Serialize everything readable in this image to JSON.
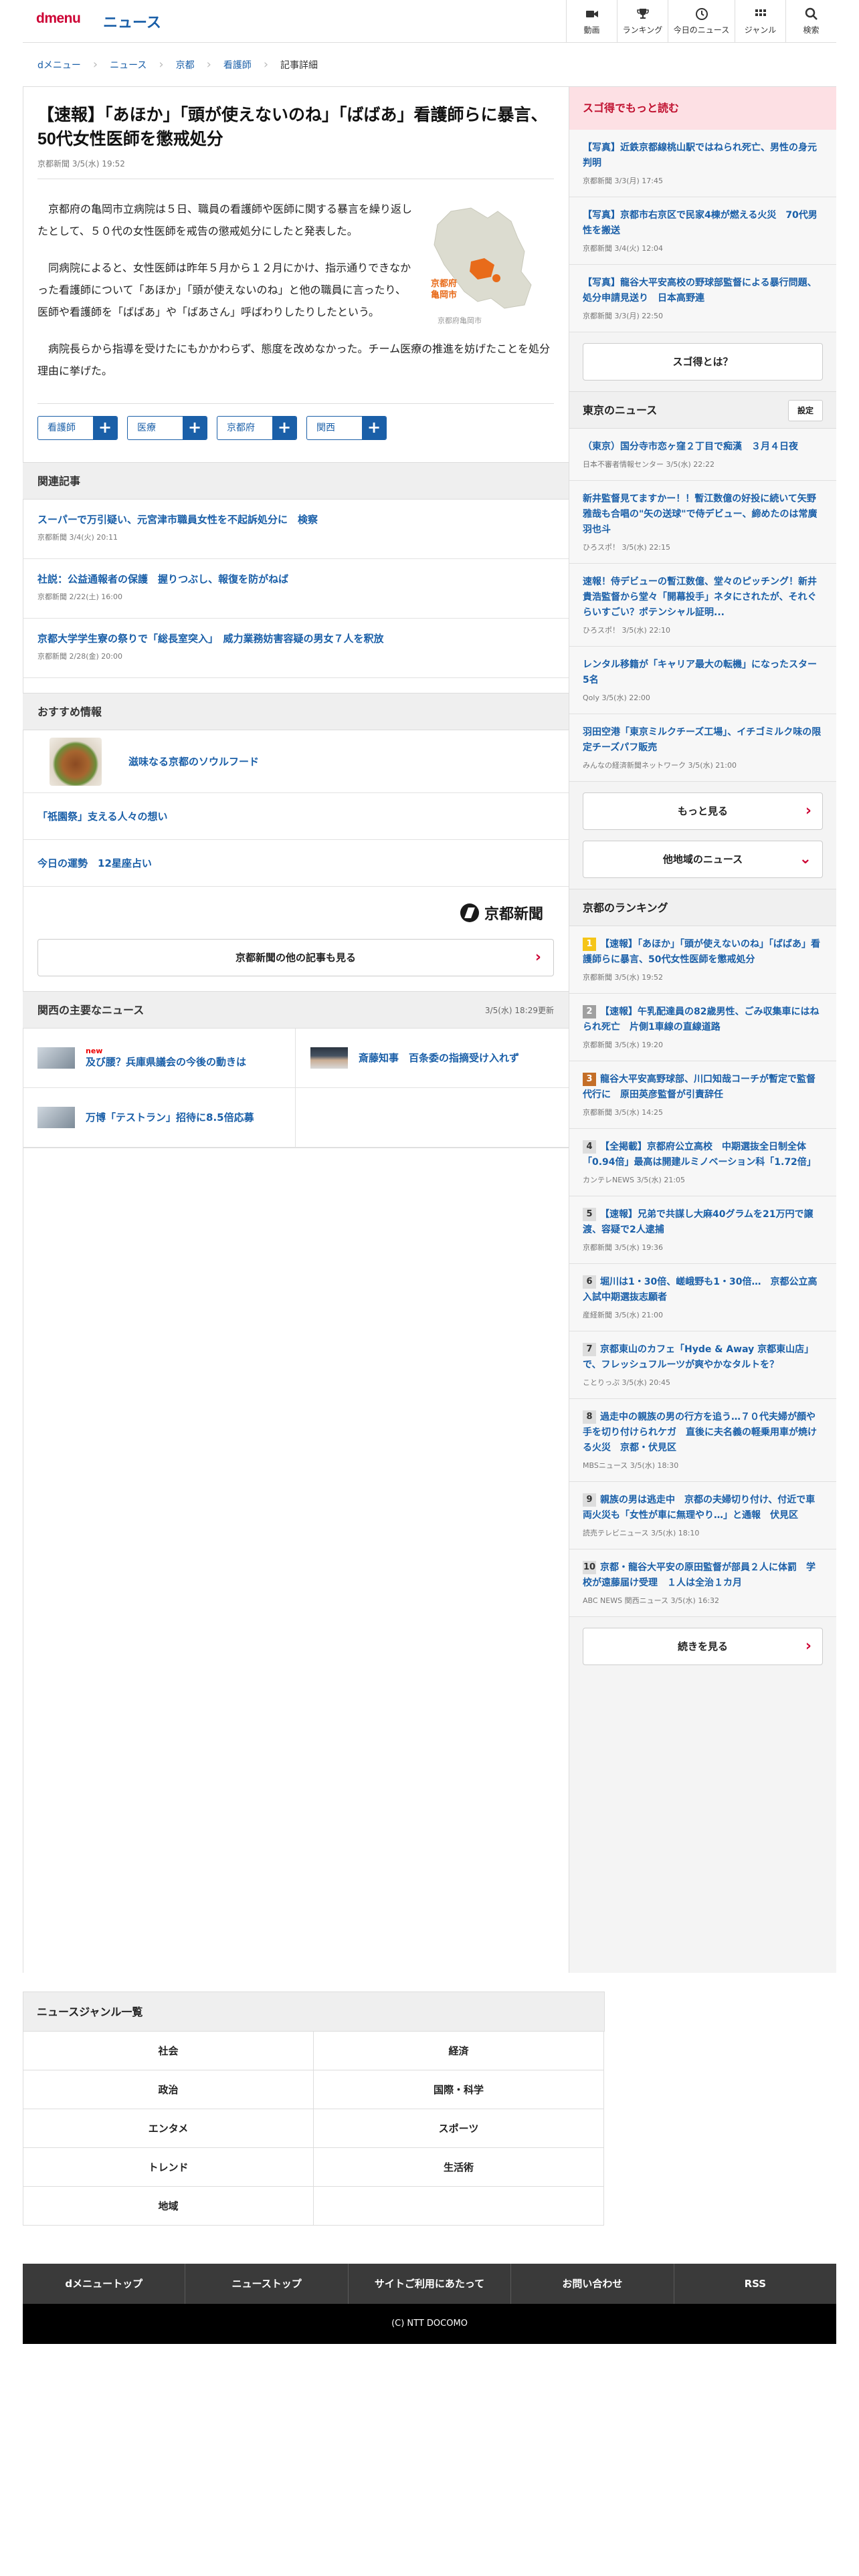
{
  "header": {
    "logo": "dmenu",
    "title": "ニュース",
    "nav": [
      {
        "label": "動画",
        "icon": "video-icon"
      },
      {
        "label": "ランキング",
        "icon": "trophy-icon"
      },
      {
        "label": "今日のニュース",
        "icon": "clock-icon"
      },
      {
        "label": "ジャンル",
        "icon": "grid-icon"
      },
      {
        "label": "検索",
        "icon": "search-icon"
      }
    ]
  },
  "breadcrumb": [
    "dメニュー",
    "ニュース",
    "京都",
    "看護師",
    "記事詳細"
  ],
  "article": {
    "title": "【速報】「あほか」「頭が使えないのね」「ばばあ」看護師らに暴言、50代女性医師を懲戒処分",
    "meta": "京都新聞 3/5(水) 19:52",
    "paragraphs": [
      "京都府の亀岡市立病院は５日、職員の看護師や医師に関する暴言を繰り返したとして、５０代の女性医師を戒告の懲戒処分にしたと発表した。",
      "同病院によると、女性医師は昨年５月から１２月にかけ、指示通りできなかった看護師について「あほか」「頭が使えないのね」と他の職員に言ったり、医師や看護師を「ばばあ」や「ばあさん」呼ばわりしたりしたという。",
      "病院長らから指導を受けたにもかかわらず、態度を改めなかった。チーム医療の推進を妨げたことを処分理由に挙げた。"
    ],
    "map_label_line1": "京都府",
    "map_label_line2": "亀岡市",
    "map_caption": "京都府亀岡市",
    "tags": [
      "看護師",
      "医療",
      "京都府",
      "関西"
    ]
  },
  "related": {
    "heading": "関連記事",
    "items": [
      {
        "title": "スーパーで万引疑い、元宮津市職員女性を不起訴処分に　検察",
        "meta": "京都新聞 3/4(火) 20:11"
      },
      {
        "title": "社説：公益通報者の保護　握りつぶし、報復を防がねば",
        "meta": "京都新聞 2/22(土) 16:00"
      },
      {
        "title": "京都大学学生寮の祭りで「総長室突入」　威力業務妨害容疑の男女７人を釈放",
        "meta": "京都新聞 2/28(金) 20:00"
      }
    ]
  },
  "recommended": {
    "heading": "おすすめ情報",
    "featured": "滋味なる京都のソウルフード",
    "items": [
      "「祇園祭」支える人々の想い",
      "今日の運勢　12星座占い"
    ],
    "publisher": "京都新聞",
    "more_button": "京都新聞の他の記事も見る"
  },
  "kansai": {
    "heading": "関西の主要なニュース",
    "updated": "3/5(水) 18:29更新",
    "items": [
      {
        "title": "及び腰？兵庫県議会の今後の動きは",
        "badge": "new"
      },
      {
        "title": "斎藤知事　百条委の指摘受け入れず",
        "badge": ""
      },
      {
        "title": "万博「テストラン」招待に8.5倍応募",
        "badge": ""
      }
    ]
  },
  "sidebar": {
    "promo_heading": "スゴ得でもっと読む",
    "promo_items": [
      {
        "title": "【写真】近鉄京都線桃山駅ではねられ死亡、男性の身元判明",
        "meta": "京都新聞 3/3(月) 17:45"
      },
      {
        "title": "【写真】京都市右京区で民家4棟が燃える火災　70代男性を搬送",
        "meta": "京都新聞 3/4(火) 12:04"
      },
      {
        "title": "【写真】龍谷大平安高校の野球部監督による暴行問題、処分申請見送り　日本高野連",
        "meta": "京都新聞 3/3(月) 22:50"
      }
    ],
    "promo_button": "スゴ得とは？",
    "tokyo_heading": "東京のニュース",
    "setting_label": "設定",
    "tokyo_items": [
      {
        "title": "（東京）国分寺市恋ヶ窪２丁目で痴漢　３月４日夜",
        "meta": "日本不審者情報センター 3/5(水) 22:22"
      },
      {
        "title": "新井監督見てますかー！！暫江数億の好投に続いて矢野雅哉も合唱の\"矢の送球\"で侍デビュー、締めたのは常廣羽也斗",
        "meta": "ひろスポ！ 3/5(水) 22:15"
      },
      {
        "title": "速報！侍デビューの暫江数億、堂々のピッチング！新井貴浩監督から堂々「開幕投手」ネタにされたが、それぐらいすごい？ポテンシャル証明...",
        "meta": "ひろスポ！ 3/5(水) 22:10"
      },
      {
        "title": "レンタル移籍が「キャリア最大の転機」になったスター5名",
        "meta": "Qoly 3/5(水) 22:00"
      },
      {
        "title": "羽田空港「東京ミルクチーズ工場」、イチゴミルク味の限定チーズパフ販売",
        "meta": "みんなの経済新聞ネットワーク 3/5(水) 21:00"
      }
    ],
    "tokyo_more": "もっと見る",
    "region_button": "他地域のニュース",
    "ranking_heading": "京都のランキング",
    "ranking": [
      {
        "rank": "1",
        "title": "【速報】「あほか」「頭が使えないのね」「ばばあ」看護師らに暴言、50代女性医師を懲戒処分",
        "meta": "京都新聞 3/5(水) 19:52"
      },
      {
        "rank": "2",
        "title": "【速報】午乳配達員の82歳男性、ごみ収集車にはねられ死亡　片側1車線の直線道路",
        "meta": "京都新聞 3/5(水) 19:20"
      },
      {
        "rank": "3",
        "title": "龍谷大平安高野球部、川口知哉コーチが暫定で監督代行に　原田英彦監督が引責辞任",
        "meta": "京都新聞 3/5(水) 14:25"
      },
      {
        "rank": "4",
        "title": "【全掲載】京都府公立高校　中期選抜全日制全体「0.94倍」最高は開建ルミノベーション科「1.72倍」",
        "meta": "カンテレNEWS 3/5(水) 21:05"
      },
      {
        "rank": "5",
        "title": "【速報】兄弟で共謀し大麻40グラムを21万円で譲渡、容疑で2人逮捕",
        "meta": "京都新聞 3/5(水) 19:36"
      },
      {
        "rank": "6",
        "title": "堀川は1・30倍、嵯峨野も1・30倍…　京都公立高入試中期選抜志願者",
        "meta": "産経新聞 3/5(水) 21:00"
      },
      {
        "rank": "7",
        "title": "京都東山のカフェ「Hyde & Away 京都東山店」で、フレッシュフルーツが爽やかなタルトを？",
        "meta": "ことりっぷ 3/5(水) 20:45"
      },
      {
        "rank": "8",
        "title": "過走中の親族の男の行方を追う…７０代夫婦が顔や手を切り付けられケガ　直後に夫名義の軽乗用車が焼ける火災　京都・伏見区",
        "meta": "MBSニュース 3/5(水) 18:30"
      },
      {
        "rank": "9",
        "title": "親族の男は逃走中　京都の夫婦切り付け、付近で車両火災も「女性が車に無理やり…」と通報　伏見区",
        "meta": "読売テレビニュース 3/5(水) 18:10"
      },
      {
        "rank": "10",
        "title": "京都・龍谷大平安の原田監督が部員２人に体罰　学校が遠藤届け受理　１人は全治１カ月",
        "meta": "ABC NEWS 関西ニュース 3/5(水) 16:32"
      }
    ],
    "ranking_more": "続きを見る"
  },
  "genre": {
    "heading": "ニュースジャンル一覧",
    "items": [
      "社会",
      "経済",
      "政治",
      "国際・科学",
      "エンタメ",
      "スポーツ",
      "トレンド",
      "生活術",
      "地域",
      ""
    ]
  },
  "footer": {
    "links": [
      "dメニュートップ",
      "ニューストップ",
      "サイトご利用にあたって",
      "お問い合わせ",
      "RSS"
    ],
    "copyright": "(C) NTT DOCOMO"
  }
}
